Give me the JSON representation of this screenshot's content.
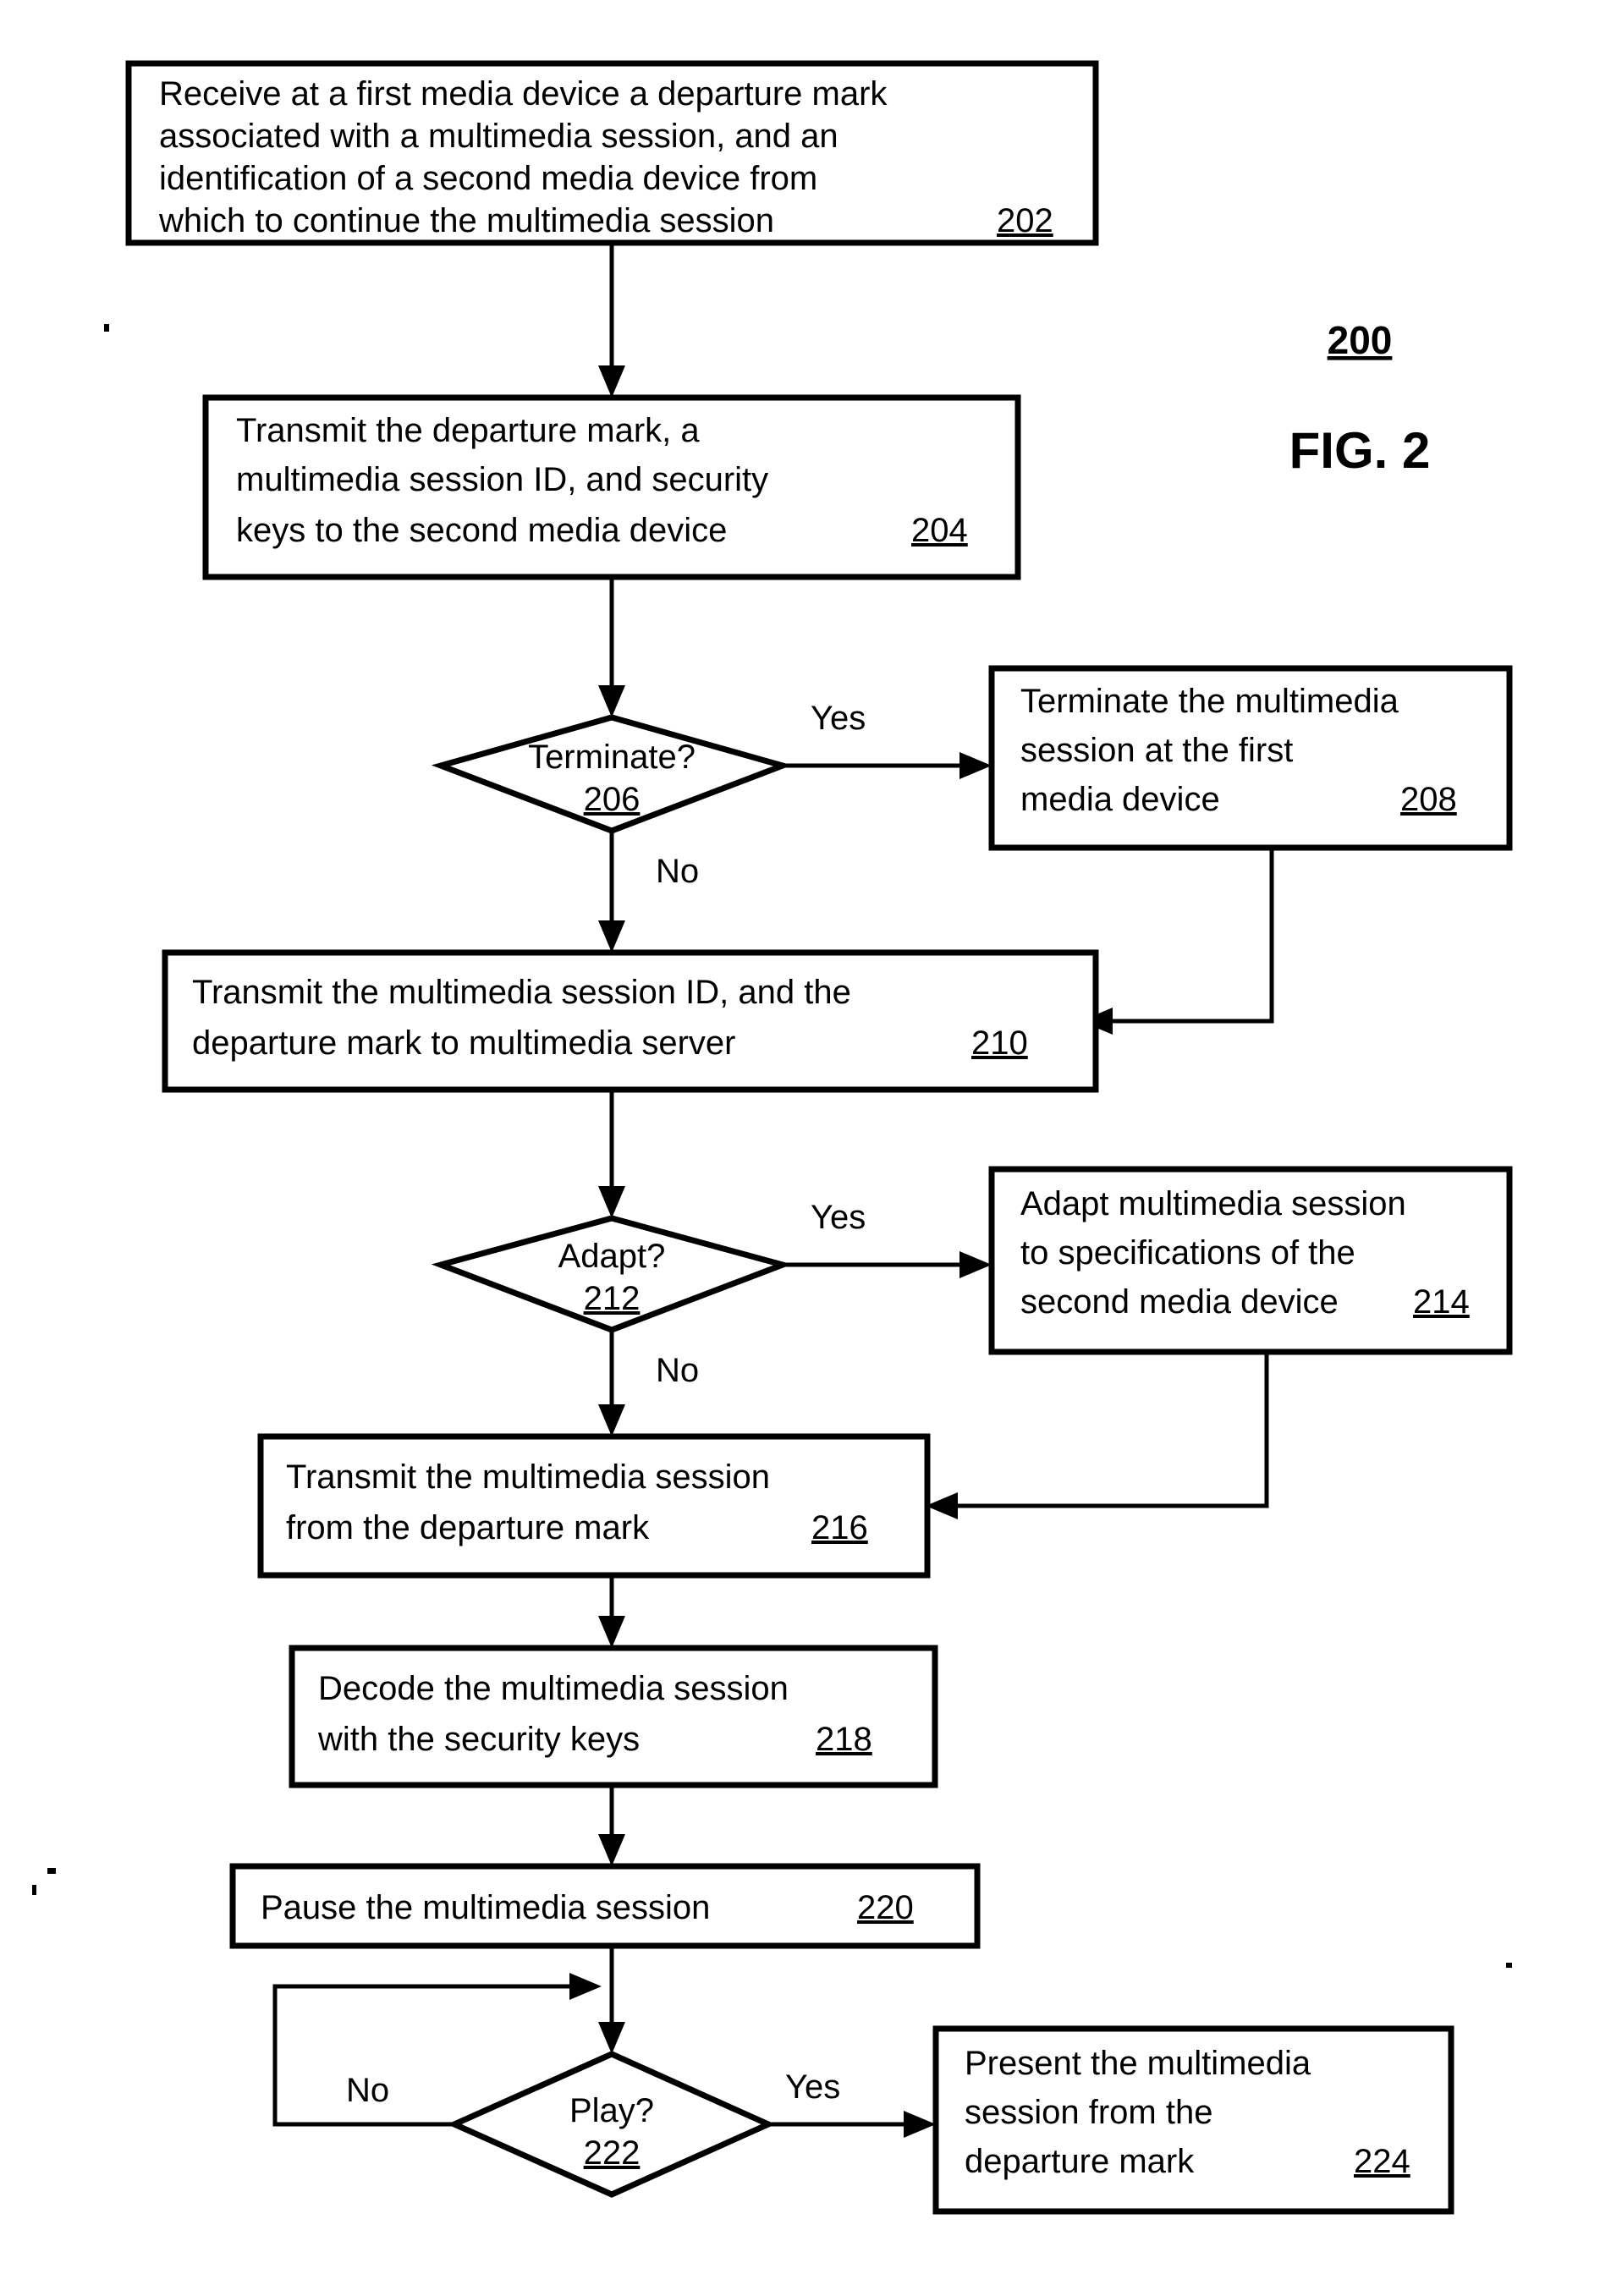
{
  "figure": {
    "reference_number": "200",
    "title": "FIG. 2"
  },
  "nodes": {
    "n202": {
      "ref": "202",
      "shape": "process",
      "lines": [
        "Receive at a first media device a departure mark",
        "associated with a multimedia session, and an",
        "identification of a second media device from",
        "which to continue the multimedia session"
      ]
    },
    "n204": {
      "ref": "204",
      "shape": "process",
      "lines": [
        "Transmit the departure mark, a",
        "multimedia session ID, and security",
        "keys to the second media device"
      ]
    },
    "n206": {
      "ref": "206",
      "shape": "decision",
      "label": "Terminate?"
    },
    "n208": {
      "ref": "208",
      "shape": "process",
      "lines": [
        "Terminate the multimedia",
        "session at the first",
        "media device"
      ]
    },
    "n210": {
      "ref": "210",
      "shape": "process",
      "lines": [
        "Transmit the multimedia session ID, and the",
        "departure mark to multimedia server"
      ]
    },
    "n212": {
      "ref": "212",
      "shape": "decision",
      "label": "Adapt?"
    },
    "n214": {
      "ref": "214",
      "shape": "process",
      "lines": [
        "Adapt multimedia session",
        "to specifications of the",
        "second media device"
      ]
    },
    "n216": {
      "ref": "216",
      "shape": "process",
      "lines": [
        "Transmit the multimedia session",
        "from the departure mark"
      ]
    },
    "n218": {
      "ref": "218",
      "shape": "process",
      "lines": [
        "Decode the multimedia session",
        "with the security keys"
      ]
    },
    "n220": {
      "ref": "220",
      "shape": "process",
      "lines": [
        "Pause the multimedia session"
      ]
    },
    "n222": {
      "ref": "222",
      "shape": "decision",
      "label": "Play?"
    },
    "n224": {
      "ref": "224",
      "shape": "process",
      "lines": [
        "Present the multimedia",
        "session from the",
        "departure mark"
      ]
    }
  },
  "branch_labels": {
    "terminate_yes": "Yes",
    "terminate_no": "No",
    "adapt_yes": "Yes",
    "adapt_no": "No",
    "play_yes": "Yes",
    "play_no": "No"
  },
  "colors": {
    "ink": "#000000",
    "paper": "#ffffff"
  }
}
